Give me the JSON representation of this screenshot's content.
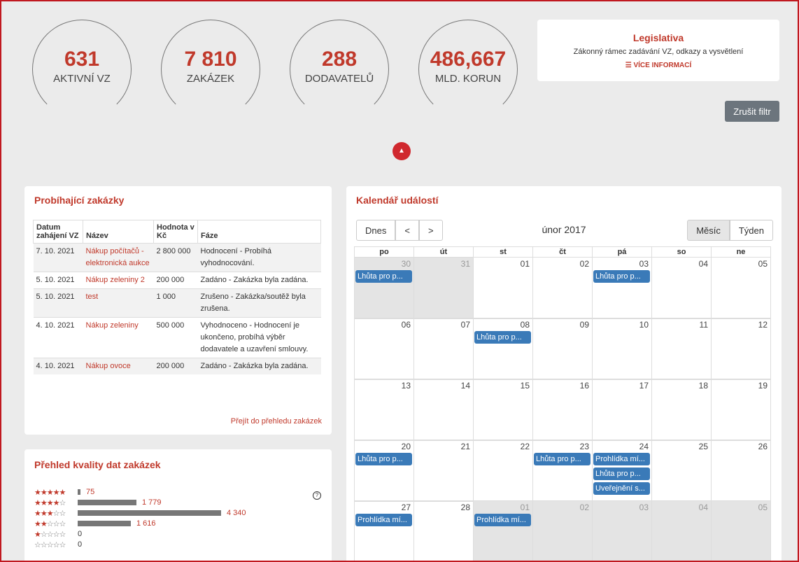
{
  "stats": [
    {
      "value": "631",
      "label": "AKTIVNÍ VZ"
    },
    {
      "value": "7 810",
      "label": "ZAKÁZEK"
    },
    {
      "value": "288",
      "label": "DODAVATELŮ"
    },
    {
      "value": "486,667",
      "label": "MLD. KORUN"
    }
  ],
  "legislativa": {
    "title": "Legislativa",
    "subtitle": "Zákonný rámec zadávání VZ, odkazy a vysvětlení",
    "more": "VÍCE INFORMACÍ"
  },
  "cancel_filter": "Zrušit filtr",
  "collapse_icon": "chevron-up-icon",
  "running": {
    "title": "Probíhající zakázky",
    "headers": [
      "Datum zahájení VZ",
      "Název",
      "Hodnota v Kč",
      "Fáze"
    ],
    "rows": [
      {
        "date": "7. 10. 2021",
        "name": "Nákup počítačů - elektronická aukce",
        "value": "2 800 000",
        "phase": "Hodnocení - Probíhá vyhodnocování."
      },
      {
        "date": "5. 10. 2021",
        "name": "Nákup zeleniny 2",
        "value": "200 000",
        "phase": "Zadáno - Zakázka byla zadána."
      },
      {
        "date": "5. 10. 2021",
        "name": "test",
        "value": "1 000",
        "phase": "Zrušeno - Zakázka/soutěž byla zrušena."
      },
      {
        "date": "4. 10. 2021",
        "name": "Nákup zeleniny",
        "value": "500 000",
        "phase": "Vyhodnoceno - Hodnocení je ukončeno, probíhá výběr dodavatele a uzavření smlouvy."
      },
      {
        "date": "4. 10. 2021",
        "name": "Nákup ovoce",
        "value": "200 000",
        "phase": "Zadáno - Zakázka byla zadána."
      }
    ],
    "link": "Přejít do přehledu zakázek"
  },
  "quality": {
    "title": "Přehled kvality dat zakázek",
    "rows": [
      {
        "stars": 5,
        "count": 75,
        "label": "75"
      },
      {
        "stars": 4,
        "count": 1779,
        "label": "1 779"
      },
      {
        "stars": 3,
        "count": 4340,
        "label": "4 340"
      },
      {
        "stars": 2,
        "count": 1616,
        "label": "1 616"
      },
      {
        "stars": 1,
        "count": 0,
        "label": "0"
      },
      {
        "stars": 0,
        "count": 0,
        "label": "0"
      }
    ]
  },
  "calendar": {
    "title": "Kalendář událostí",
    "today": "Dnes",
    "prev": "<",
    "next": ">",
    "month_title": "únor 2017",
    "view_month": "Měsíc",
    "view_week": "Týden",
    "dows": [
      "po",
      "út",
      "st",
      "čt",
      "pá",
      "so",
      "ne"
    ],
    "weeks": [
      [
        {
          "d": "30",
          "o": true,
          "ev": [
            "Lhůta pro p..."
          ]
        },
        {
          "d": "31",
          "o": true,
          "ev": []
        },
        {
          "d": "01",
          "ev": []
        },
        {
          "d": "02",
          "ev": []
        },
        {
          "d": "03",
          "ev": [
            "Lhůta pro p..."
          ]
        },
        {
          "d": "04",
          "ev": []
        },
        {
          "d": "05",
          "ev": []
        }
      ],
      [
        {
          "d": "06",
          "ev": []
        },
        {
          "d": "07",
          "ev": []
        },
        {
          "d": "08",
          "ev": [
            "Lhůta pro p..."
          ]
        },
        {
          "d": "09",
          "ev": []
        },
        {
          "d": "10",
          "ev": []
        },
        {
          "d": "11",
          "ev": []
        },
        {
          "d": "12",
          "ev": []
        }
      ],
      [
        {
          "d": "13",
          "ev": []
        },
        {
          "d": "14",
          "ev": []
        },
        {
          "d": "15",
          "ev": []
        },
        {
          "d": "16",
          "ev": []
        },
        {
          "d": "17",
          "ev": []
        },
        {
          "d": "18",
          "ev": []
        },
        {
          "d": "19",
          "ev": []
        }
      ],
      [
        {
          "d": "20",
          "ev": [
            "Lhůta pro p..."
          ]
        },
        {
          "d": "21",
          "ev": []
        },
        {
          "d": "22",
          "ev": []
        },
        {
          "d": "23",
          "ev": [
            "Lhůta pro p..."
          ]
        },
        {
          "d": "24",
          "ev": [
            "Prohlídka mí...",
            "Lhůta pro p...",
            "Uveřejnění s..."
          ]
        },
        {
          "d": "25",
          "ev": []
        },
        {
          "d": "26",
          "ev": []
        }
      ],
      [
        {
          "d": "27",
          "ev": [
            "Prohlídka mí..."
          ]
        },
        {
          "d": "28",
          "ev": []
        },
        {
          "d": "01",
          "o": true,
          "ev": [
            "Prohlídka mí..."
          ]
        },
        {
          "d": "02",
          "o": true,
          "ev": []
        },
        {
          "d": "03",
          "o": true,
          "ev": []
        },
        {
          "d": "04",
          "o": true,
          "ev": []
        },
        {
          "d": "05",
          "o": true,
          "ev": []
        }
      ]
    ]
  }
}
